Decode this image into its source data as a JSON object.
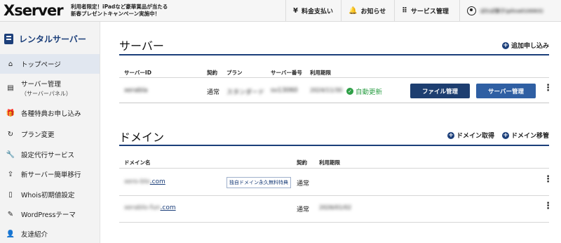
{
  "header": {
    "logo": "Xserver",
    "promo_line1": "利用者限定！iPadなど豪華賞品が当たる",
    "promo_line2": "新春プレゼントキャンペーン実施中！",
    "nav": [
      {
        "label": "料金支払い",
        "icon": "yen-icon"
      },
      {
        "label": "お知らせ",
        "icon": "bell-icon"
      },
      {
        "label": "サービス管理",
        "icon": "grid-icon"
      }
    ],
    "user_name": "ぽわぽ寮子(pliva010063)"
  },
  "sidebar": {
    "title": "レンタルサーバー",
    "items": [
      {
        "label": "トップページ",
        "icon": "home-icon",
        "active": true
      },
      {
        "label": "サーバー管理",
        "sub": "（サーバーパネル）",
        "icon": "server-icon"
      },
      {
        "label": "各種特典お申し込み",
        "icon": "gift-icon"
      },
      {
        "label": "プラン変更",
        "icon": "refresh-icon"
      },
      {
        "label": "設定代行サービス",
        "icon": "wrench-icon"
      },
      {
        "label": "新サーバー簡単移行",
        "icon": "upload-icon"
      },
      {
        "label": "Whois初期値設定",
        "icon": "document-icon"
      },
      {
        "label": "WordPressテーマ",
        "icon": "edit-icon"
      },
      {
        "label": "友達紹介",
        "icon": "person-icon"
      }
    ]
  },
  "server": {
    "title": "サーバー",
    "add_link": "追加申し込み",
    "headers": [
      "サーバーID",
      "契約",
      "プラン",
      "サーバー番号",
      "利用期限"
    ],
    "row": {
      "id": "xerabla",
      "contract": "通常",
      "plan": "スタンダード",
      "number": "sv13060",
      "expiry": "2024/11/30",
      "status": "自動更新",
      "file_button": "ファイル管理",
      "server_button": "サーバー管理"
    }
  },
  "domain": {
    "title": "ドメイン",
    "get_link": "ドメイン取得",
    "move_link": "ドメイン移管",
    "headers": [
      "ドメイン名",
      "契約",
      "利用期限"
    ],
    "rows": [
      {
        "name_blur": "xero-blo",
        "tld": ".com",
        "badge": "独自ドメイン永久無料特典",
        "contract": "通常",
        "expiry": ""
      },
      {
        "name_blur": "xerablo-fun",
        "tld": ".com",
        "badge": "",
        "contract": "通常",
        "expiry": "2026/01/02"
      }
    ]
  },
  "colors": {
    "accent": "#1c3f7a",
    "ok": "#2e9f47"
  }
}
